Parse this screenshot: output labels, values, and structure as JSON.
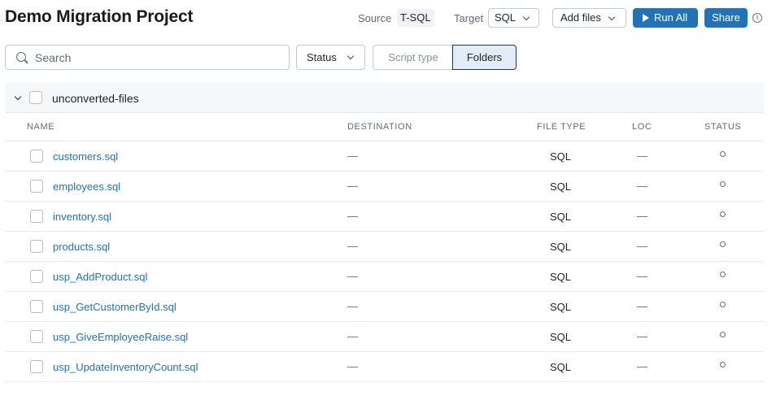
{
  "header": {
    "title": "Demo Migration Project",
    "source_label": "Source",
    "source_value": "T-SQL",
    "target_label": "Target",
    "target_value": "SQL",
    "add_files_label": "Add files",
    "run_all_label": "Run All",
    "share_label": "Share",
    "info_glyph": "i"
  },
  "toolbar": {
    "search_placeholder": "Search",
    "status_filter_label": "Status",
    "script_type_label": "Script type",
    "folders_label": "Folders",
    "folders_active": true
  },
  "folder": {
    "name": "unconverted-files",
    "expanded": true
  },
  "table": {
    "columns": {
      "name": "NAME",
      "destination": "DESTINATION",
      "file_type": "FILE TYPE",
      "loc": "LOC",
      "status": "STATUS"
    },
    "rows": [
      {
        "name": "customers.sql",
        "destination": "—",
        "file_type": "SQL",
        "loc": "—"
      },
      {
        "name": "employees.sql",
        "destination": "—",
        "file_type": "SQL",
        "loc": "—"
      },
      {
        "name": "inventory.sql",
        "destination": "—",
        "file_type": "SQL",
        "loc": "—"
      },
      {
        "name": "products.sql",
        "destination": "—",
        "file_type": "SQL",
        "loc": "—"
      },
      {
        "name": "usp_AddProduct.sql",
        "destination": "—",
        "file_type": "SQL",
        "loc": "—"
      },
      {
        "name": "usp_GetCustomerById.sql",
        "destination": "—",
        "file_type": "SQL",
        "loc": "—"
      },
      {
        "name": "usp_GiveEmployeeRaise.sql",
        "destination": "—",
        "file_type": "SQL",
        "loc": "—"
      },
      {
        "name": "usp_UpdateInventoryCount.sql",
        "destination": "—",
        "file_type": "SQL",
        "loc": "—"
      }
    ]
  },
  "colors": {
    "accent": "#2272b4",
    "link": "#2272b4",
    "segment_active_bg": "#e3edf7"
  },
  "icons": {
    "search": "search-icon",
    "chevron": "chevron-down-icon",
    "play": "play-icon",
    "info": "info-icon",
    "status": "status-pending-icon"
  }
}
